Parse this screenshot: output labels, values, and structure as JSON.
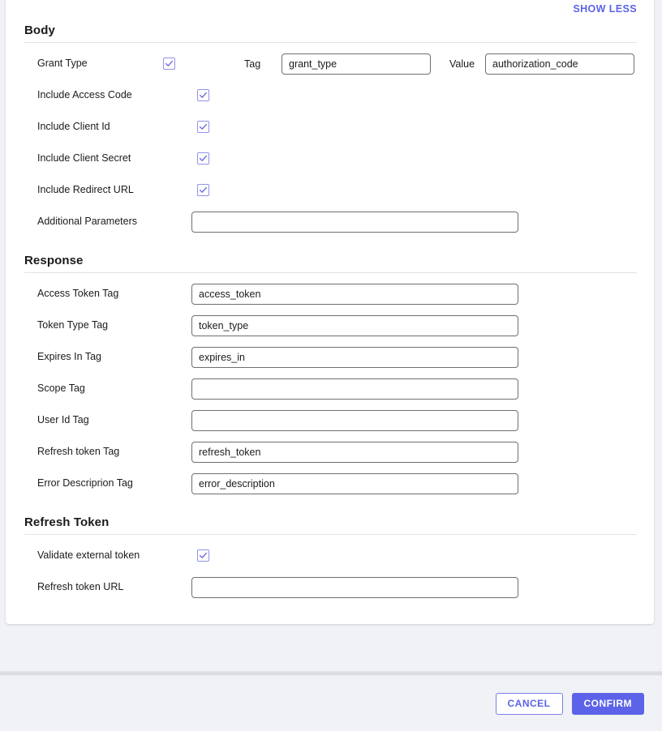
{
  "colors": {
    "accent": "#5c63e8",
    "checkbox_border": "#8f93e8",
    "input_border": "#6f6f73",
    "page_background": "#f1f2f5",
    "card_background": "#ffffff",
    "divider": "#e4e4e6",
    "text": "#1b1b1b"
  },
  "header": {
    "show_less_label": "SHOW LESS"
  },
  "sections": {
    "body": {
      "title": "Body",
      "grant_type": {
        "label": "Grant Type",
        "checked": true,
        "tag_label": "Tag",
        "tag_value": "grant_type",
        "tag_placeholder": "",
        "value_label": "Value",
        "value_value": "authorization_code",
        "value_placeholder": ""
      },
      "checkbox_rows": [
        {
          "label": "Include Access Code",
          "checked": true
        },
        {
          "label": "Include Client Id",
          "checked": true
        },
        {
          "label": "Include Client Secret",
          "checked": true
        },
        {
          "label": "Include Redirect URL",
          "checked": true
        }
      ],
      "additional_parameters": {
        "label": "Additional Parameters",
        "value": "",
        "placeholder": ""
      }
    },
    "response": {
      "title": "Response",
      "fields": [
        {
          "label": "Access Token Tag",
          "value": "access_token",
          "placeholder": ""
        },
        {
          "label": "Token Type Tag",
          "value": "token_type",
          "placeholder": ""
        },
        {
          "label": "Expires In Tag",
          "value": "expires_in",
          "placeholder": ""
        },
        {
          "label": "Scope Tag",
          "value": "",
          "placeholder": ""
        },
        {
          "label": "User Id Tag",
          "value": "",
          "placeholder": ""
        },
        {
          "label": "Refresh token Tag",
          "value": "refresh_token",
          "placeholder": ""
        },
        {
          "label": "Error Descriprion Tag",
          "value": "error_description",
          "placeholder": ""
        }
      ]
    },
    "refresh_token": {
      "title": "Refresh Token",
      "validate": {
        "label": "Validate external token",
        "checked": true
      },
      "url_field": {
        "label": "Refresh token URL",
        "value": "",
        "placeholder": ""
      }
    }
  },
  "footer": {
    "cancel_label": "CANCEL",
    "confirm_label": "CONFIRM"
  }
}
